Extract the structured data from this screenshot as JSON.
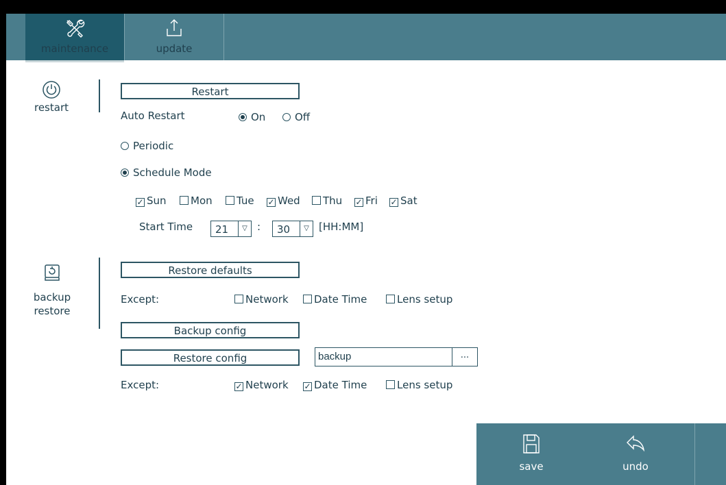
{
  "tabs": [
    {
      "label": "maintenance",
      "icon": "wrench-screwdriver-icon",
      "active": true
    },
    {
      "label": "update",
      "icon": "upload-icon",
      "active": false
    }
  ],
  "restart_section": {
    "side_label": "restart",
    "icon": "power-icon",
    "restart_button": "Restart",
    "auto_restart_label": "Auto Restart",
    "on_label": "On",
    "off_label": "Off",
    "auto_restart_value": "On",
    "periodic_label": "Periodic",
    "schedule_label": "Schedule Mode",
    "mode_value": "Schedule Mode",
    "days": [
      {
        "label": "Sun",
        "checked": true
      },
      {
        "label": "Mon",
        "checked": false
      },
      {
        "label": "Tue",
        "checked": false
      },
      {
        "label": "Wed",
        "checked": true
      },
      {
        "label": "Thu",
        "checked": false
      },
      {
        "label": "Fri",
        "checked": true
      },
      {
        "label": "Sat",
        "checked": true
      }
    ],
    "start_time_label": "Start Time",
    "hour": "21",
    "minute": "30",
    "colon": ":",
    "time_format": "[HH:MM]"
  },
  "backup_section": {
    "side_label_1": "backup",
    "side_label_2": "restore",
    "icon": "disk-restore-icon",
    "restore_defaults_button": "Restore defaults",
    "except_label": "Except:",
    "defaults_except": [
      {
        "label": "Network",
        "checked": false
      },
      {
        "label": "Date Time",
        "checked": false
      },
      {
        "label": "Lens setup",
        "checked": false
      }
    ],
    "backup_config_button": "Backup config",
    "restore_config_button": "Restore config",
    "restore_file_value": "backup",
    "browse_label": "...",
    "config_except": [
      {
        "label": "Network",
        "checked": true
      },
      {
        "label": "Date Time",
        "checked": true
      },
      {
        "label": "Lens setup",
        "checked": false
      }
    ]
  },
  "footer": {
    "save_label": "save",
    "undo_label": "undo"
  },
  "colors": {
    "toolbar": "#4a7d8c",
    "active_tab": "#1f5a6b",
    "text": "#1f3f4d"
  }
}
